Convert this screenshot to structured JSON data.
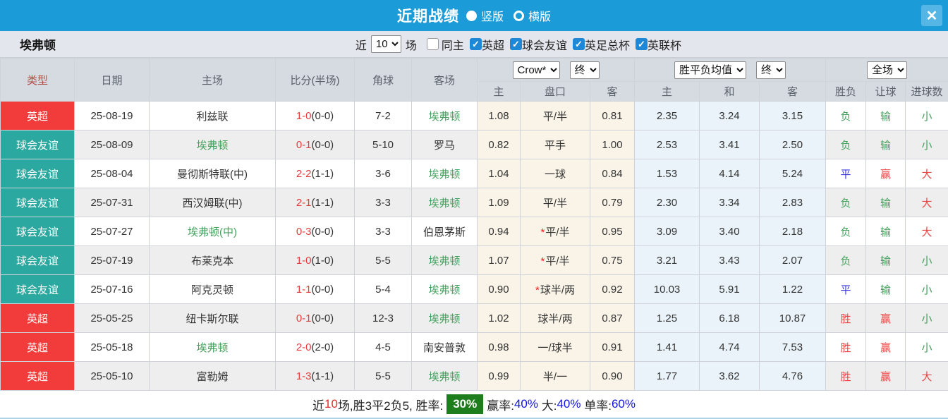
{
  "titlebar": {
    "title": "近期战绩",
    "radios": [
      {
        "label": "竖版",
        "selected": true
      },
      {
        "label": "横版",
        "selected": false
      }
    ],
    "close": "✕"
  },
  "filters": {
    "team": "埃弗顿",
    "recent_label": "近",
    "recent_value": "10",
    "matches_label": "场",
    "same_home": {
      "label": "同主",
      "checked": false
    },
    "competitions": [
      {
        "label": "英超",
        "checked": true
      },
      {
        "label": "球会友谊",
        "checked": true
      },
      {
        "label": "英足总杯",
        "checked": true
      },
      {
        "label": "英联杯",
        "checked": true
      }
    ]
  },
  "table": {
    "columns": {
      "type": "类型",
      "date": "日期",
      "home": "主场",
      "score": "比分(半场)",
      "corners": "角球",
      "away": "客场"
    },
    "dropdowns": {
      "bookmaker": "Crow*",
      "bookmaker_state": "终",
      "europe": "胜平负均值",
      "europe_state": "终",
      "scope": "全场"
    },
    "subcolumns": {
      "asian_home": "主",
      "handicap": "盘口",
      "asian_away": "客",
      "euro_home": "主",
      "euro_draw": "和",
      "euro_away": "客",
      "result": "胜负",
      "handicap_result": "让球",
      "goals_result": "进球数"
    },
    "rows": [
      {
        "type": "英超",
        "type_color": "red",
        "date": "25-08-19",
        "home": "利兹联",
        "home_everton": false,
        "score": "1-0",
        "half": "(0-0)",
        "corners": "7-2",
        "away": "埃弗顿",
        "away_everton": true,
        "asian_home": "1.08",
        "handicap": "平/半",
        "handicap_star": false,
        "asian_away": "0.81",
        "euro_home": "2.35",
        "euro_draw": "3.24",
        "euro_away": "3.15",
        "result": "负",
        "result_color": "green",
        "handicap_result": "输",
        "handicap_result_color": "green",
        "goals_result": "小",
        "goals_result_color": "green"
      },
      {
        "type": "球会友谊",
        "type_color": "teal",
        "date": "25-08-09",
        "home": "埃弗顿",
        "home_everton": true,
        "score": "0-1",
        "half": "(0-0)",
        "corners": "5-10",
        "away": "罗马",
        "away_everton": false,
        "asian_home": "0.82",
        "handicap": "平手",
        "handicap_star": false,
        "asian_away": "1.00",
        "euro_home": "2.53",
        "euro_draw": "3.41",
        "euro_away": "2.50",
        "result": "负",
        "result_color": "green",
        "handicap_result": "输",
        "handicap_result_color": "green",
        "goals_result": "小",
        "goals_result_color": "green"
      },
      {
        "type": "球会友谊",
        "type_color": "teal",
        "date": "25-08-04",
        "home": "曼彻斯特联(中)",
        "home_everton": false,
        "score": "2-2",
        "half": "(1-1)",
        "corners": "3-6",
        "away": "埃弗顿",
        "away_everton": true,
        "asian_home": "1.04",
        "handicap": "一球",
        "handicap_star": false,
        "asian_away": "0.84",
        "euro_home": "1.53",
        "euro_draw": "4.14",
        "euro_away": "5.24",
        "result": "平",
        "result_color": "blue",
        "handicap_result": "赢",
        "handicap_result_color": "red",
        "goals_result": "大",
        "goals_result_color": "red"
      },
      {
        "type": "球会友谊",
        "type_color": "teal",
        "date": "25-07-31",
        "home": "西汉姆联(中)",
        "home_everton": false,
        "score": "2-1",
        "half": "(1-1)",
        "corners": "3-3",
        "away": "埃弗顿",
        "away_everton": true,
        "asian_home": "1.09",
        "handicap": "平/半",
        "handicap_star": false,
        "asian_away": "0.79",
        "euro_home": "2.30",
        "euro_draw": "3.34",
        "euro_away": "2.83",
        "result": "负",
        "result_color": "green",
        "handicap_result": "输",
        "handicap_result_color": "green",
        "goals_result": "大",
        "goals_result_color": "red"
      },
      {
        "type": "球会友谊",
        "type_color": "teal",
        "date": "25-07-27",
        "home": "埃弗顿(中)",
        "home_everton": true,
        "score": "0-3",
        "half": "(0-0)",
        "corners": "3-3",
        "away": "伯恩茅斯",
        "away_everton": false,
        "asian_home": "0.94",
        "handicap": "平/半",
        "handicap_star": true,
        "asian_away": "0.95",
        "euro_home": "3.09",
        "euro_draw": "3.40",
        "euro_away": "2.18",
        "result": "负",
        "result_color": "green",
        "handicap_result": "输",
        "handicap_result_color": "green",
        "goals_result": "大",
        "goals_result_color": "red"
      },
      {
        "type": "球会友谊",
        "type_color": "teal",
        "date": "25-07-19",
        "home": "布莱克本",
        "home_everton": false,
        "score": "1-0",
        "half": "(1-0)",
        "corners": "5-5",
        "away": "埃弗顿",
        "away_everton": true,
        "asian_home": "1.07",
        "handicap": "平/半",
        "handicap_star": true,
        "asian_away": "0.75",
        "euro_home": "3.21",
        "euro_draw": "3.43",
        "euro_away": "2.07",
        "result": "负",
        "result_color": "green",
        "handicap_result": "输",
        "handicap_result_color": "green",
        "goals_result": "小",
        "goals_result_color": "green"
      },
      {
        "type": "球会友谊",
        "type_color": "teal",
        "date": "25-07-16",
        "home": "阿克灵顿",
        "home_everton": false,
        "score": "1-1",
        "half": "(0-0)",
        "corners": "5-4",
        "away": "埃弗顿",
        "away_everton": true,
        "asian_home": "0.90",
        "handicap": "球半/两",
        "handicap_star": true,
        "asian_away": "0.92",
        "euro_home": "10.03",
        "euro_draw": "5.91",
        "euro_away": "1.22",
        "result": "平",
        "result_color": "blue",
        "handicap_result": "输",
        "handicap_result_color": "green",
        "goals_result": "小",
        "goals_result_color": "green"
      },
      {
        "type": "英超",
        "type_color": "red",
        "date": "25-05-25",
        "home": "纽卡斯尔联",
        "home_everton": false,
        "score": "0-1",
        "half": "(0-0)",
        "corners": "12-3",
        "away": "埃弗顿",
        "away_everton": true,
        "asian_home": "1.02",
        "handicap": "球半/两",
        "handicap_star": false,
        "asian_away": "0.87",
        "euro_home": "1.25",
        "euro_draw": "6.18",
        "euro_away": "10.87",
        "result": "胜",
        "result_color": "red",
        "handicap_result": "赢",
        "handicap_result_color": "red",
        "goals_result": "小",
        "goals_result_color": "green"
      },
      {
        "type": "英超",
        "type_color": "red",
        "date": "25-05-18",
        "home": "埃弗顿",
        "home_everton": true,
        "score": "2-0",
        "half": "(2-0)",
        "corners": "4-5",
        "away": "南安普敦",
        "away_everton": false,
        "asian_home": "0.98",
        "handicap": "一/球半",
        "handicap_star": false,
        "asian_away": "0.91",
        "euro_home": "1.41",
        "euro_draw": "4.74",
        "euro_away": "7.53",
        "result": "胜",
        "result_color": "red",
        "handicap_result": "赢",
        "handicap_result_color": "red",
        "goals_result": "小",
        "goals_result_color": "green"
      },
      {
        "type": "英超",
        "type_color": "red",
        "date": "25-05-10",
        "home": "富勒姆",
        "home_everton": false,
        "score": "1-3",
        "half": "(1-1)",
        "corners": "5-5",
        "away": "埃弗顿",
        "away_everton": true,
        "asian_home": "0.99",
        "handicap": "半/一",
        "handicap_star": false,
        "asian_away": "0.90",
        "euro_home": "1.77",
        "euro_draw": "3.62",
        "euro_away": "4.76",
        "result": "胜",
        "result_color": "red",
        "handicap_result": "赢",
        "handicap_result_color": "red",
        "goals_result": "大",
        "goals_result_color": "red"
      }
    ]
  },
  "footer": {
    "segments": [
      {
        "text": "近",
        "style": "black"
      },
      {
        "text": "10",
        "style": "red"
      },
      {
        "text": "场,胜3平2负5, 胜率:",
        "style": "black"
      },
      {
        "text": "30%",
        "style": "greenbox"
      },
      {
        "text": "赢率:",
        "style": "black"
      },
      {
        "text": "40%",
        "style": "blue"
      },
      {
        "text": " 大:",
        "style": "black"
      },
      {
        "text": "40%",
        "style": "blue"
      },
      {
        "text": " 单率:",
        "style": "black"
      },
      {
        "text": "60%",
        "style": "blue"
      }
    ]
  }
}
